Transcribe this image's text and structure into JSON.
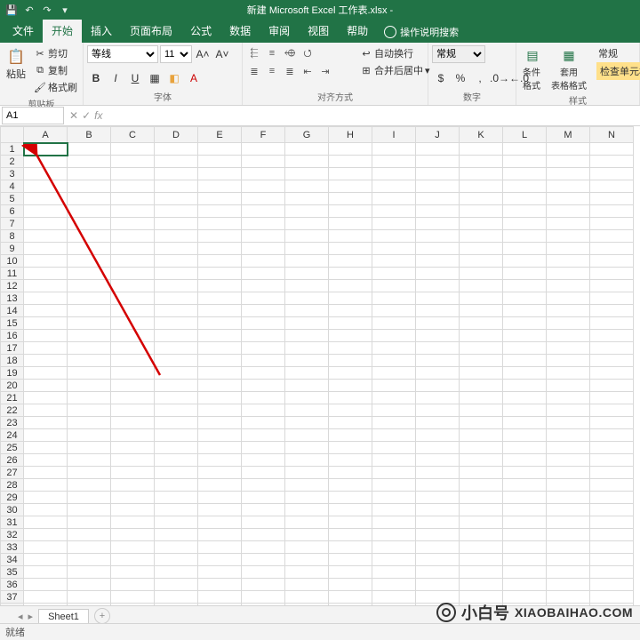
{
  "title": "新建 Microsoft Excel 工作表.xlsx -",
  "tabs": [
    "文件",
    "开始",
    "插入",
    "页面布局",
    "公式",
    "数据",
    "审阅",
    "视图",
    "帮助"
  ],
  "search_hint": "操作说明搜索",
  "clipboard": {
    "paste": "粘贴",
    "cut": "剪切",
    "copy": "复制",
    "format": "格式刷",
    "label": "剪贴板"
  },
  "font": {
    "name": "等线",
    "size": "11",
    "label": "字体"
  },
  "align": {
    "wrap": "自动换行",
    "merge": "合并后居中",
    "label": "对齐方式"
  },
  "number": {
    "format": "常规",
    "label": "数字"
  },
  "styles": {
    "cond": "条件格式",
    "table": "套用\n表格格式",
    "cell": "检查单元格",
    "label": "样式",
    "mode": "常规"
  },
  "namebox": "A1",
  "columns": [
    "A",
    "B",
    "C",
    "D",
    "E",
    "F",
    "G",
    "H",
    "I",
    "J",
    "K",
    "L",
    "M",
    "N"
  ],
  "rows": 38,
  "sheet_tab": "Sheet1",
  "status": "就绪",
  "watermark_cn": "小白号",
  "watermark_en": "XIAOBAIHAO.COM"
}
